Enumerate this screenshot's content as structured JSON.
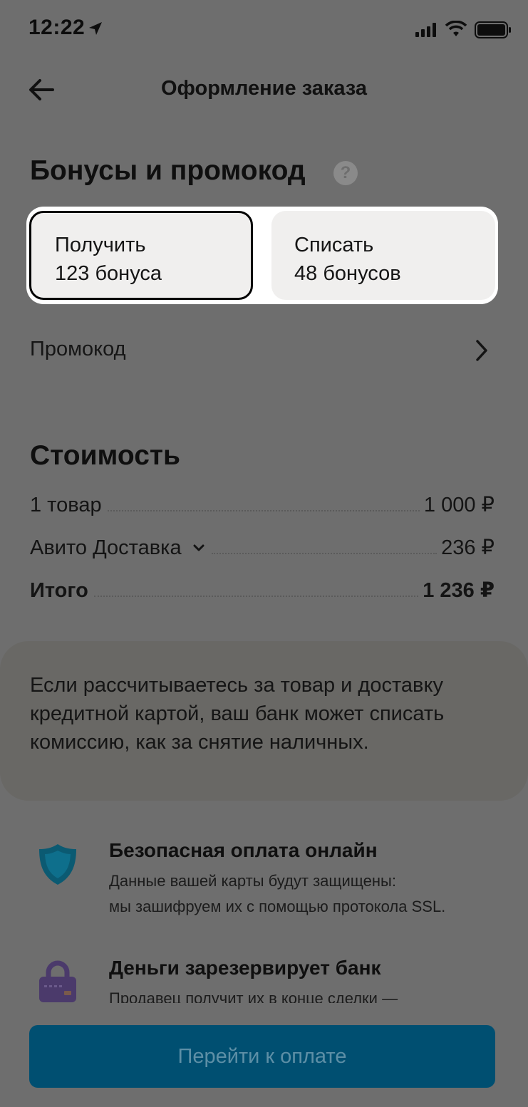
{
  "status_bar": {
    "time": "12:22"
  },
  "nav": {
    "title": "Оформление заказа"
  },
  "bonuses": {
    "title": "Бонусы и промокод",
    "help_glyph": "?",
    "receive": {
      "line1": "Получить",
      "line2": "123 бонуса"
    },
    "spend": {
      "line1": "Списать",
      "line2": "48 бонусов"
    },
    "promo_label": "Промокод"
  },
  "cost": {
    "title": "Стоимость",
    "rows": [
      {
        "label": "1 товар",
        "value": "1 000 ₽"
      },
      {
        "label": "Авито Доставка",
        "value": "236 ₽"
      },
      {
        "label": "Итого",
        "value": "1 236 ₽"
      }
    ]
  },
  "notice": {
    "lines": [
      "Если рассчитываетесь за товар и доставку",
      "кредитной картой, ваш банк может списать",
      "комиссию, как за снятие наличных."
    ]
  },
  "features": [
    {
      "title": "Безопасная оплата онлайн",
      "lines": [
        "Данные вашей карты будут защищены:",
        "мы зашифруем их с помощью протокола SSL."
      ],
      "icon": "shield-icon",
      "color": "#0b5a72"
    },
    {
      "title": "Деньги зарезервирует банк",
      "lines": [
        "Продавец получит их в конце сделки —"
      ],
      "icon": "lock-icon",
      "color": "#4b3a6b"
    }
  ],
  "pay_button": {
    "label": "Перейти к оплате"
  },
  "colors": {
    "accent": "#004f71",
    "background": "#6e6e6e"
  }
}
